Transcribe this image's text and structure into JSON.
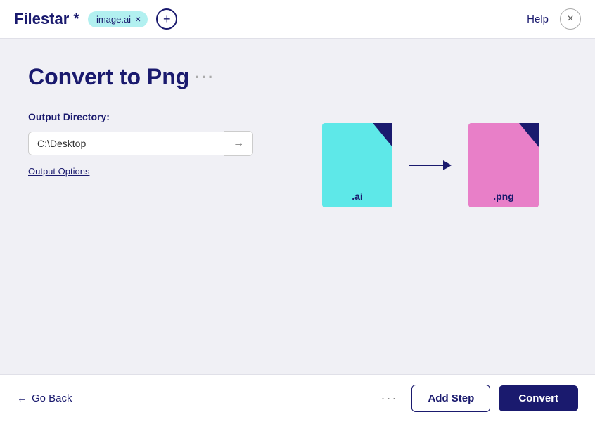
{
  "app": {
    "title": "Filestar *"
  },
  "header": {
    "file_tag": "image.ai",
    "close_tag_label": "×",
    "add_file_label": "+",
    "help_label": "Help",
    "close_label": "×"
  },
  "main": {
    "page_title": "Convert to Png",
    "title_dots": "···",
    "output_directory_label": "Output Directory:",
    "directory_value": "C:\\Desktop",
    "directory_arrow": "→",
    "output_options_label": "Output Options",
    "illustration": {
      "from_label": ".ai",
      "to_label": ".png"
    }
  },
  "footer": {
    "go_back_label": "Go Back",
    "more_dots": "···",
    "add_step_label": "Add Step",
    "convert_label": "Convert"
  }
}
